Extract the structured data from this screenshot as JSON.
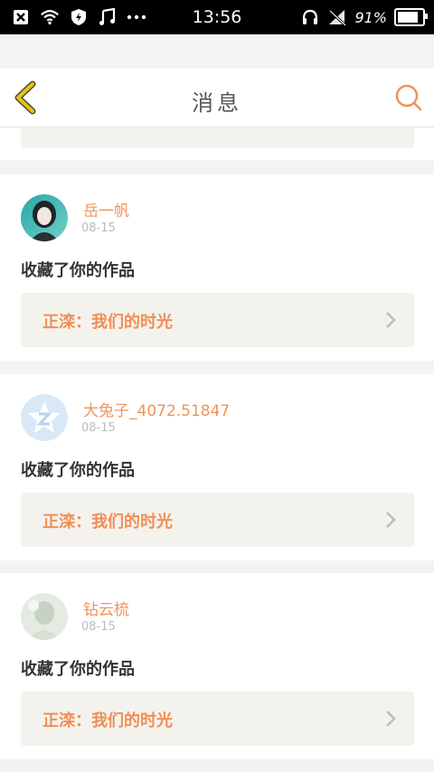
{
  "status_bar": {
    "time": "13:56",
    "battery_percent": "91%",
    "battery_level": 0.91,
    "left_icons": [
      "close-box-icon",
      "wifi-icon",
      "shield-icon",
      "music-note-icon",
      "more-dots-icon"
    ],
    "right_icons": [
      "headphones-icon",
      "no-signal-icon",
      "battery-icon"
    ]
  },
  "header": {
    "title": "消息"
  },
  "messages": [
    {
      "name": "岳一帆",
      "date": "08-15",
      "action": "收藏了你的作品",
      "work": "正滦：我们的时光"
    },
    {
      "name": "大兔子_4072.51847",
      "date": "08-15",
      "action": "收藏了你的作品",
      "work": "正滦：我们的时光"
    },
    {
      "name": "钻云梳",
      "date": "08-15",
      "action": "收藏了你的作品",
      "work": "正滦：我们的时光"
    }
  ],
  "colors": {
    "accent": "#f0925a",
    "back_arrow": "#e8c400",
    "card_bg": "#f4f2ec"
  }
}
